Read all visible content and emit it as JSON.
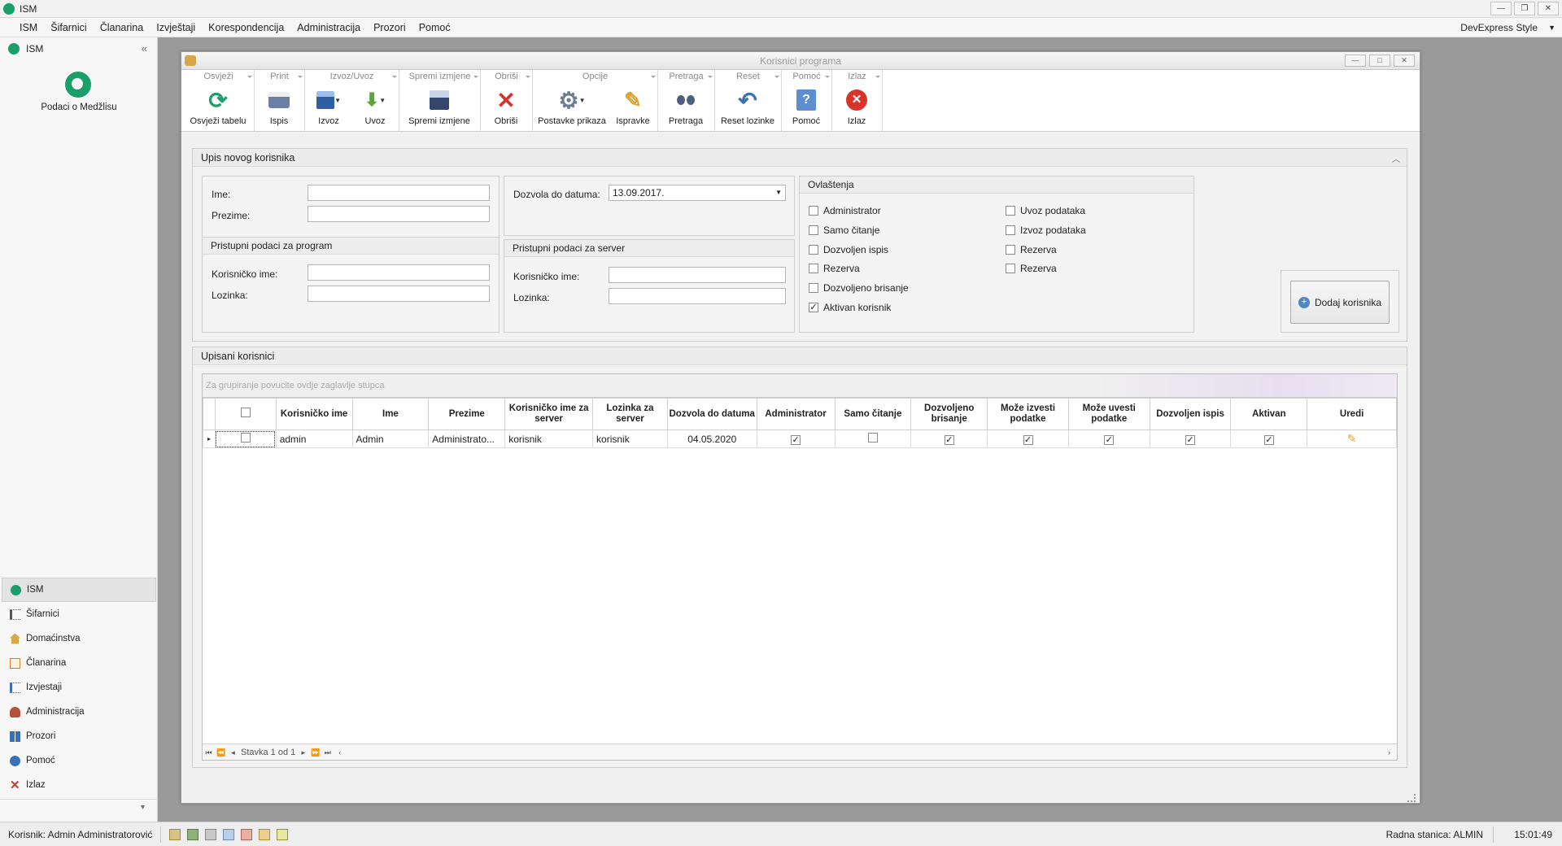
{
  "app": {
    "title": "ISM",
    "window_controls": [
      "minimize-icon",
      "restore-icon",
      "close-icon"
    ]
  },
  "menu": {
    "items": [
      "ISM",
      "Šifarnici",
      "Članarina",
      "Izvještaji",
      "Korespondencija",
      "Administracija",
      "Prozori",
      "Pomoć"
    ],
    "style": "DevExpress Style"
  },
  "sidebar": {
    "header": "ISM",
    "logo_label": "Podaci o Medžlisu",
    "nav": [
      {
        "label": "ISM",
        "icon": "ism-icon"
      },
      {
        "label": "Šifarnici",
        "icon": "list-icon"
      },
      {
        "label": "Domaćinstva",
        "icon": "house-icon"
      },
      {
        "label": "Članarina",
        "icon": "calendar-icon"
      },
      {
        "label": "Izvjestaji",
        "icon": "report-list-icon"
      },
      {
        "label": "Administracija",
        "icon": "users-icon"
      },
      {
        "label": "Prozori",
        "icon": "windows-icon"
      },
      {
        "label": "Pomoć",
        "icon": "help-icon"
      },
      {
        "label": "Izlaz",
        "icon": "exit-icon"
      }
    ]
  },
  "window": {
    "title": "Korisnici programa"
  },
  "ribbon": {
    "groups": [
      {
        "title": "Osvježi",
        "buttons": [
          {
            "label": "Osvježi tabelu",
            "icon": "refresh-icon"
          }
        ]
      },
      {
        "title": "Print",
        "buttons": [
          {
            "label": "Ispis",
            "icon": "printer-icon"
          }
        ]
      },
      {
        "title": "Izvoz/Uvoz",
        "buttons": [
          {
            "label": "Izvoz",
            "icon": "export-icon"
          },
          {
            "label": "Uvoz",
            "icon": "import-icon"
          }
        ]
      },
      {
        "title": "Spremi izmjene",
        "buttons": [
          {
            "label": "Spremi izmjene",
            "icon": "save-icon"
          }
        ]
      },
      {
        "title": "Obriši",
        "buttons": [
          {
            "label": "Obriši",
            "icon": "delete-icon"
          }
        ]
      },
      {
        "title": "Opcije",
        "buttons": [
          {
            "label": "Postavke prikaza",
            "icon": "gear-icon"
          },
          {
            "label": "Ispravke",
            "icon": "edit-pencil-icon"
          }
        ]
      },
      {
        "title": "Pretraga",
        "buttons": [
          {
            "label": "Pretraga",
            "icon": "binoculars-icon"
          }
        ]
      },
      {
        "title": "Reset",
        "buttons": [
          {
            "label": "Reset lozinke",
            "icon": "undo-icon"
          }
        ]
      },
      {
        "title": "Pomoć",
        "buttons": [
          {
            "label": "Pomoć",
            "icon": "help-book-icon"
          }
        ]
      },
      {
        "title": "Izlaz",
        "buttons": [
          {
            "label": "Izlaz",
            "icon": "exit-circle-icon"
          }
        ]
      }
    ]
  },
  "form": {
    "panel_title": "Upis novog korisnika",
    "ime_label": "Ime:",
    "ime_value": "",
    "prezime_label": "Prezime:",
    "prezime_value": "",
    "dozvola_label": "Dozvola do datuma:",
    "dozvola_value": "13.09.2017.",
    "program_group": "Pristupni podaci za program",
    "server_group": "Pristupni podaci za server",
    "korisnicko_label": "Korisničko ime:",
    "lozinka_label": "Lozinka:",
    "permissions_group": "Ovlaštenja",
    "permissions_left": [
      {
        "label": "Administrator",
        "checked": false
      },
      {
        "label": "Samo čitanje",
        "checked": false
      },
      {
        "label": "Dozvoljen ispis",
        "checked": false
      },
      {
        "label": "Rezerva",
        "checked": false
      },
      {
        "label": "Dozvoljeno brisanje",
        "checked": false
      },
      {
        "label": "Aktivan korisnik",
        "checked": true
      }
    ],
    "permissions_right": [
      {
        "label": "Uvoz podataka",
        "checked": false
      },
      {
        "label": "Izvoz podataka",
        "checked": false
      },
      {
        "label": "Rezerva",
        "checked": false
      },
      {
        "label": "Rezerva",
        "checked": false
      }
    ],
    "add_button": "Dodaj korisnika"
  },
  "users_panel": {
    "title": "Upisani korisnici",
    "group_hint": "Za grupiranje povucite ovdje zaglavlje stupca",
    "columns": [
      "Korisničko ime",
      "Ime",
      "Prezime",
      "Korisničko ime za server",
      "Lozinka za server",
      "Dozvola do datuma",
      "Administrator",
      "Samo čitanje",
      "Dozvoljeno brisanje",
      "Može izvesti podatke",
      "Može uvesti podatke",
      "Dozvoljen ispis",
      "Aktivan",
      "Uredi"
    ],
    "rows": [
      {
        "korisnicko": "admin",
        "ime": "Admin",
        "prezime": "Administrato...",
        "server_user": "korisnik",
        "server_pass": "korisnik",
        "datum": "04.05.2020",
        "flags": [
          true,
          false,
          true,
          true,
          true,
          true,
          true
        ]
      }
    ],
    "pager": "Stavka 1 od 1"
  },
  "status": {
    "user": "Korisnik: Admin Administratorović",
    "workstation": "Radna stanica: ALMIN",
    "time": "15:01:49"
  },
  "colors": {
    "brand_green": "#1a9e6a",
    "delete_red": "#d9342b",
    "accent_blue": "#3b6fb6"
  }
}
